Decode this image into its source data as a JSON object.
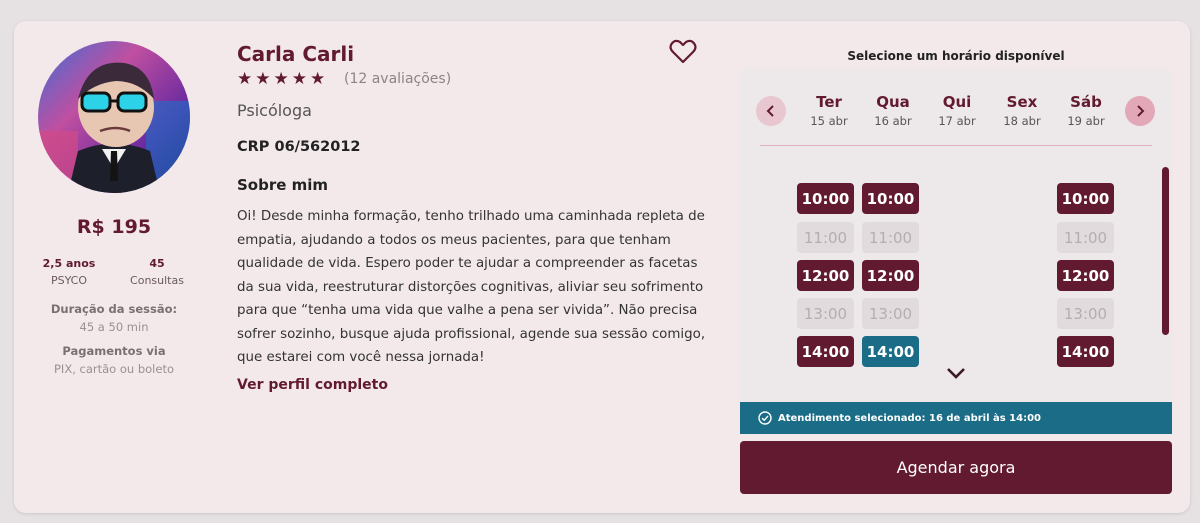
{
  "profile": {
    "name": "Carla Carli",
    "stars": "★★★★★",
    "reviews": "(12 avaliações)",
    "role": "Psicóloga",
    "crp": "CRP 06/562012",
    "about_title": "Sobre mim",
    "about": "Oi! Desde minha formação, tenho trilhado uma caminhada repleta de empatia, ajudando a todos os meus pacientes, para que tenham qualidade de vida. Espero poder te ajudar a compreender as facetas da sua vida, reestruturar distorções cognitivas, aliviar seu sofrimento para que “tenha uma vida que valhe a pena ser vivida”. Não precisa sofrer sozinho, busque ajuda profissional, agende sua sessão comigo, que estarei com você nessa jornada!",
    "full_profile_link": "Ver perfil completo",
    "rating": 5
  },
  "sidebar": {
    "price": "R$ 195",
    "stats": [
      {
        "value": "2,5 anos",
        "label": "PSYCO"
      },
      {
        "value": "45",
        "label": "Consultas"
      }
    ],
    "session_title": "Duração da sessão:",
    "session_value": "45 a 50 min",
    "payment_title": "Pagamentos via",
    "payment_value": "PIX, cartão ou boleto"
  },
  "schedule": {
    "title": "Selecione um horário disponível",
    "days": [
      {
        "name": "Ter",
        "date": "15 abr"
      },
      {
        "name": "Qua",
        "date": "16 abr"
      },
      {
        "name": "Qui",
        "date": "17 abr"
      },
      {
        "name": "Sex",
        "date": "18 abr"
      },
      {
        "name": "Sáb",
        "date": "19 abr"
      }
    ],
    "slots": {
      "ter": [
        {
          "time": "10:00",
          "state": "available"
        },
        {
          "time": "11:00",
          "state": "disabled"
        },
        {
          "time": "12:00",
          "state": "available"
        },
        {
          "time": "13:00",
          "state": "disabled"
        },
        {
          "time": "14:00",
          "state": "available"
        }
      ],
      "qua": [
        {
          "time": "10:00",
          "state": "available"
        },
        {
          "time": "11:00",
          "state": "disabled"
        },
        {
          "time": "12:00",
          "state": "available"
        },
        {
          "time": "13:00",
          "state": "disabled"
        },
        {
          "time": "14:00",
          "state": "selected"
        }
      ],
      "sab": [
        {
          "time": "10:00",
          "state": "available"
        },
        {
          "time": "11:00",
          "state": "disabled"
        },
        {
          "time": "12:00",
          "state": "available"
        },
        {
          "time": "13:00",
          "state": "disabled"
        },
        {
          "time": "14:00",
          "state": "available"
        }
      ]
    },
    "confirmation": "Atendimento selecionado: 16 de abril às 14:00",
    "cta": "Agendar agora"
  },
  "icons": {
    "favorite": "heart-icon",
    "prev": "chevron-left-icon",
    "next": "chevron-right-icon",
    "more": "chevron-down-icon",
    "confirm": "check-circle-icon"
  },
  "colors": {
    "brand": "#621a30",
    "selected": "#1b6c86",
    "disabled": "#e1dbdd",
    "card": "#f3e9eb"
  }
}
